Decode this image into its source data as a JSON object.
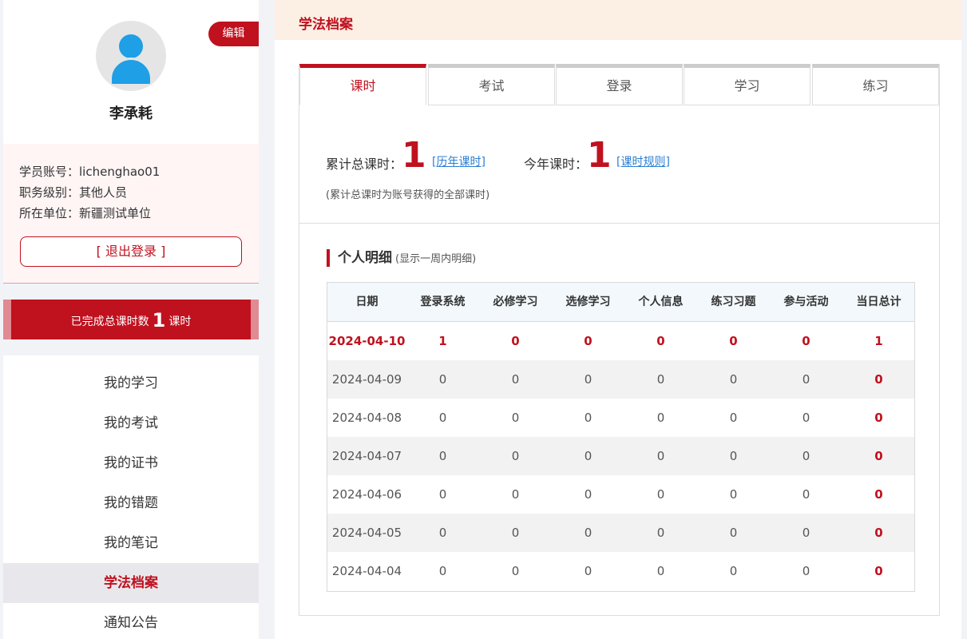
{
  "profile": {
    "edit_label": "编辑",
    "name": "李承耗",
    "account": "学员账号：lichenghao01",
    "level": "职务级别：其他人员",
    "unit": "所在单位：新疆测试单位",
    "logout_label": "[ 退出登录 ]"
  },
  "hours_bar": {
    "prefix": "已完成总课时数",
    "value": "1",
    "suffix": "课时"
  },
  "menu": {
    "items": [
      "我的学习",
      "我的考试",
      "我的证书",
      "我的错题",
      "我的笔记",
      "学法档案",
      "通知公告"
    ],
    "active": "学法档案"
  },
  "header": {
    "title": "学法档案"
  },
  "tabs": [
    "课时",
    "考试",
    "登录",
    "学习",
    "练习"
  ],
  "summary": {
    "total_label": "累计总课时：",
    "total_value": "1",
    "history_link": "[历年课时]",
    "year_label": "今年课时：",
    "year_value": "1",
    "rules_link": "[课时规则]",
    "note": "(累计总课时为账号获得的全部课时)"
  },
  "detail": {
    "title": "个人明细",
    "subtitle": "(显示一周内明细)"
  },
  "table": {
    "columns": [
      "日期",
      "登录系统",
      "必修学习",
      "选修学习",
      "个人信息",
      "练习习题",
      "参与活动",
      "当日总计"
    ],
    "rows": [
      [
        "2024-04-10",
        "1",
        "0",
        "0",
        "0",
        "0",
        "0",
        "1"
      ],
      [
        "2024-04-09",
        "0",
        "0",
        "0",
        "0",
        "0",
        "0",
        "0"
      ],
      [
        "2024-04-08",
        "0",
        "0",
        "0",
        "0",
        "0",
        "0",
        "0"
      ],
      [
        "2024-04-07",
        "0",
        "0",
        "0",
        "0",
        "0",
        "0",
        "0"
      ],
      [
        "2024-04-06",
        "0",
        "0",
        "0",
        "0",
        "0",
        "0",
        "0"
      ],
      [
        "2024-04-05",
        "0",
        "0",
        "0",
        "0",
        "0",
        "0",
        "0"
      ],
      [
        "2024-04-04",
        "0",
        "0",
        "0",
        "0",
        "0",
        "0",
        "0"
      ]
    ]
  },
  "colors": {
    "accent": "#c0111f",
    "header_bg": "#fcefe4",
    "avatar": "#1e9fe6"
  }
}
